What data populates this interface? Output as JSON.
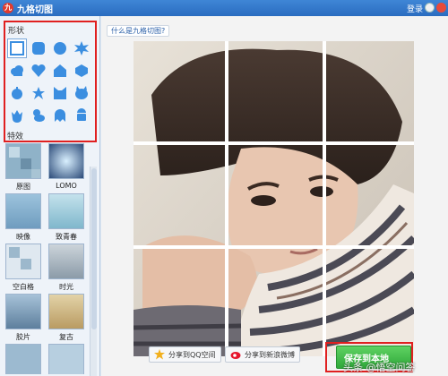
{
  "window": {
    "title": "九格切图",
    "login_label": "登录"
  },
  "shapes": {
    "section_label": "形状",
    "items": [
      "square",
      "rounded-square",
      "circle",
      "star-burst",
      "cloud",
      "heart",
      "house",
      "hexagon",
      "apple",
      "star",
      "cat-face",
      "cat-head",
      "tulip",
      "duck",
      "ghost",
      "android"
    ]
  },
  "effects": {
    "section_label": "特效",
    "items": [
      {
        "label": "原图"
      },
      {
        "label": "LOMO"
      },
      {
        "label": "映像"
      },
      {
        "label": "致青春"
      },
      {
        "label": "空白格"
      },
      {
        "label": "时光"
      },
      {
        "label": "胶片"
      },
      {
        "label": "复古"
      }
    ]
  },
  "main": {
    "help_link": "什么是九格切图?",
    "share_qzone": "分享到QQ空间",
    "share_weibo": "分享到新浪微博",
    "save_button": "保存到本地"
  },
  "watermark": "头条 @悟空问答",
  "colors": {
    "titlebar": "#2a6cc0",
    "highlight_box": "#e02020",
    "save_green": "#2fa83a",
    "shape_blue": "#3b8ee0"
  }
}
